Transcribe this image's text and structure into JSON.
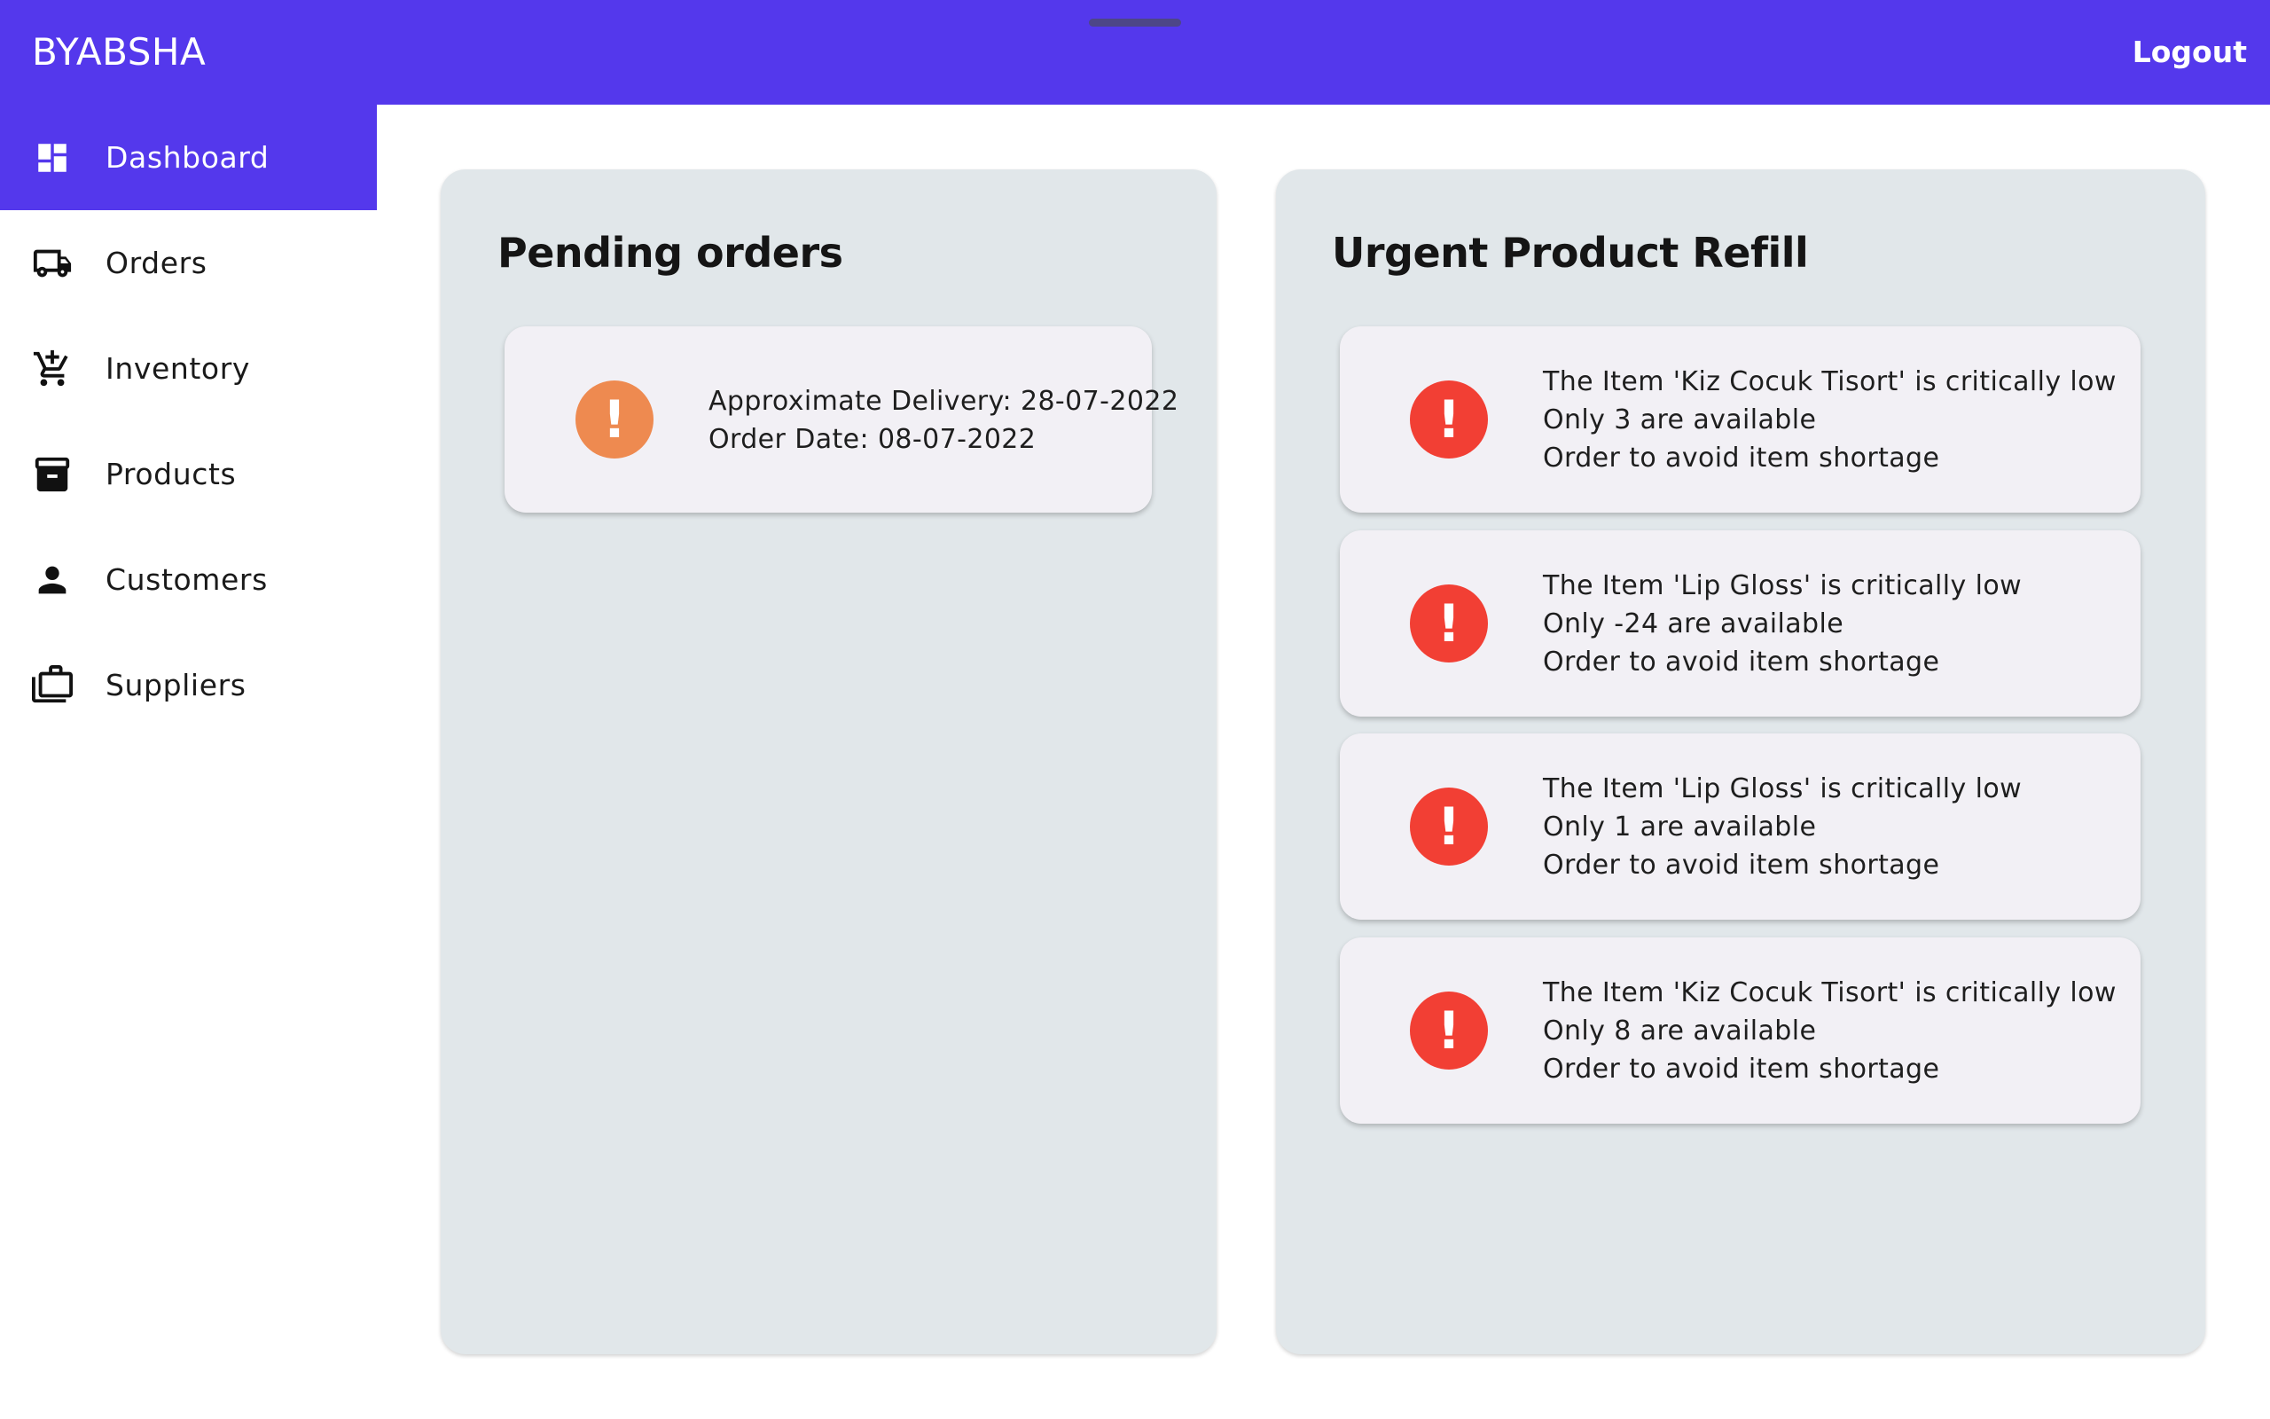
{
  "app": {
    "brand": "BYABSHA",
    "logout_label": "Logout"
  },
  "sidebar": {
    "items": [
      {
        "label": "Dashboard",
        "icon": "dashboard-icon",
        "active": true
      },
      {
        "label": "Orders",
        "icon": "truck-icon",
        "active": false
      },
      {
        "label": "Inventory",
        "icon": "cart-icon",
        "active": false
      },
      {
        "label": "Products",
        "icon": "archive-box-icon",
        "active": false
      },
      {
        "label": "Customers",
        "icon": "person-icon",
        "active": false
      },
      {
        "label": "Suppliers",
        "icon": "briefcase-icon",
        "active": false
      }
    ]
  },
  "pending": {
    "title": "Pending orders",
    "orders": [
      {
        "line1": "Approximate Delivery: 28-07-2022",
        "line2": "Order Date: 08-07-2022"
      }
    ]
  },
  "refill": {
    "title": "Urgent Product Refill",
    "items": [
      {
        "line1": "The Item 'Kiz Cocuk Tisort' is critically low",
        "line2": "Only 3 are available",
        "line3": "Order to avoid item shortage"
      },
      {
        "line1": "The Item 'Lip Gloss' is critically low",
        "line2": "Only -24 are available",
        "line3": "Order to avoid item shortage"
      },
      {
        "line1": "The Item 'Lip Gloss' is critically low",
        "line2": "Only 1 are available",
        "line3": "Order to avoid item shortage"
      },
      {
        "line1": "The Item 'Kiz Cocuk Tisort' is critically low",
        "line2": "Only 8 are available",
        "line3": "Order to avoid item shortage"
      }
    ]
  },
  "alert_symbol": "!",
  "colors": {
    "primary": "#5438ec",
    "panel_bg": "#e1e7ea",
    "card_bg": "#f2f0f5",
    "warning_orange": "#ee8a50",
    "critical_red": "#f23f34"
  }
}
